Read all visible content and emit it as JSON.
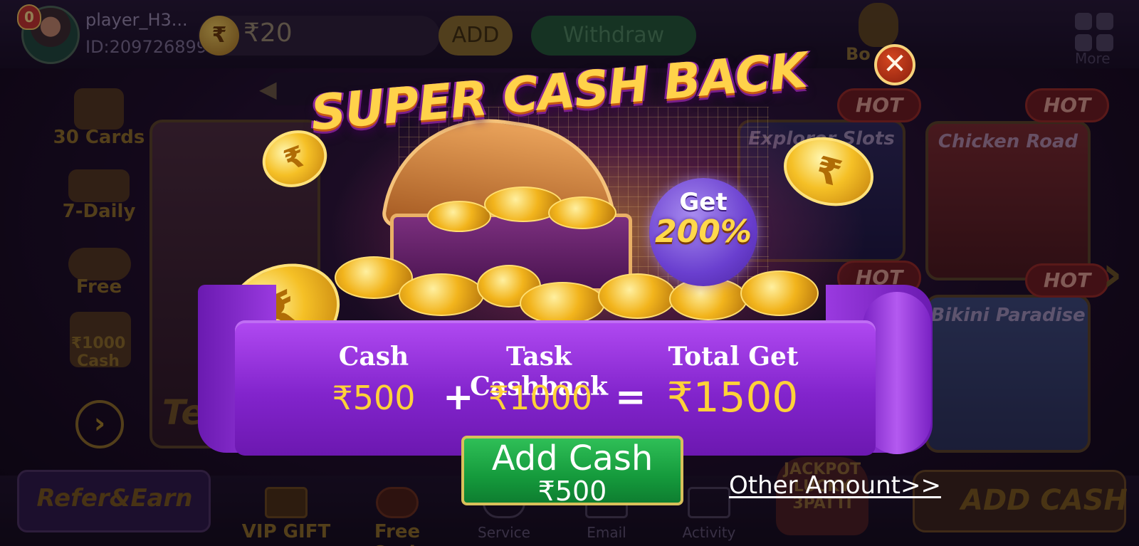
{
  "header": {
    "vip_level": "0",
    "player_name": "player_H3...",
    "player_id": "ID:209726899",
    "currency_symbol": "₹",
    "balance": "₹20",
    "add_label": "ADD",
    "withdraw_label": "Withdraw",
    "bonus_label": "Bo",
    "more_label": "More"
  },
  "sidebar": {
    "items": [
      {
        "label": "30 Cards"
      },
      {
        "label": "7-Daily"
      },
      {
        "label": "Free"
      },
      {
        "label": "₹1000 Cash"
      }
    ]
  },
  "games": {
    "left_partial": "Te",
    "explorer": "Explorer Slots",
    "chicken": "Chicken Road",
    "bikini": "Bikini Paradise",
    "hot_tag": "HOT"
  },
  "bottom_nav": {
    "refer": "Refer&Earn",
    "vip_gift": "VIP GIFT",
    "free_cash": "Free Cash",
    "service": "Service",
    "email": "Email",
    "activity": "Activity",
    "jackpot": "JACKPOT LUCKY 3PATTI",
    "add_cash_banner": "ADD CASH"
  },
  "popup": {
    "title": "SUPER CASH BACK",
    "close_symbol": "✕",
    "get_label": "Get",
    "get_percent": "200%",
    "columns": [
      {
        "head": "Cash",
        "value": "₹500"
      },
      {
        "head": "Task Cashback",
        "value": "₹1000"
      },
      {
        "head": "Total Get",
        "value": "₹1500"
      }
    ],
    "plus": "+",
    "equals": "=",
    "add_cash_label": "Add Cash",
    "add_cash_amount": "₹500",
    "other_amount": "Other Amount>>"
  },
  "colors": {
    "gold": "#ffd238",
    "ribbon_purple": "#8224cc",
    "button_green": "#159a3c",
    "close_red": "#d4461f"
  },
  "icons": [
    "rupee-coin-icon",
    "speaker-icon",
    "more-grid-icon",
    "close-icon",
    "chevron-right-icon",
    "treasure-chest-icon"
  ]
}
